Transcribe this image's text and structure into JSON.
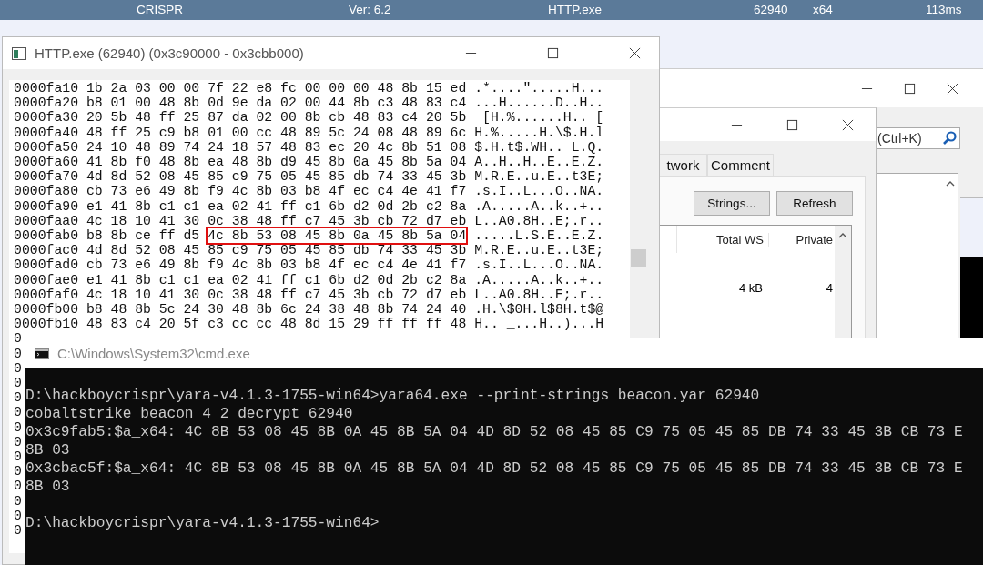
{
  "status_bar": {
    "items": [
      "CRISPR",
      "Ver: 6.2",
      "HTTP.exe",
      "62940",
      "x64",
      "113ms"
    ]
  },
  "main_window": {
    "search": {
      "placeholder": "(Ctrl+K)"
    }
  },
  "properties_window": {
    "tabs": [
      {
        "label": "twork",
        "selected": false
      },
      {
        "label": "Comment",
        "selected": false
      }
    ],
    "buttons": [
      "Strings...",
      "Refresh"
    ],
    "columns": [
      "Total WS",
      "Private"
    ],
    "rows": [
      {
        "total_ws": "4 kB",
        "private": "4"
      }
    ]
  },
  "hex_window": {
    "title": "HTTP.exe (62940) (0x3c90000 - 0x3cbb000)",
    "rows": [
      {
        "offset": "0000fa10",
        "segments": [
          {
            "text": "1b 2a 03 00 00 7f 22 e8 fc 00 00 00 48 8b 15 ed",
            "highlighted": false
          }
        ],
        "ascii": ".*....\".....H..."
      },
      {
        "offset": "0000fa20",
        "segments": [
          {
            "text": "b8 01 00 48 8b 0d 9e da 02 00 44 8b c3 48 83 c4",
            "highlighted": false
          }
        ],
        "ascii": "...H......D..H.."
      },
      {
        "offset": "0000fa30",
        "segments": [
          {
            "text": "20 5b 48 ff 25 87 da 02 00 8b cb 48 83 c4 20 5b",
            "highlighted": false
          }
        ],
        "ascii": " [H.%......H.. ["
      },
      {
        "offset": "0000fa40",
        "segments": [
          {
            "text": "48 ff 25 c9 b8 01 00 cc 48 89 5c 24 08 48 89 6c",
            "highlighted": false
          }
        ],
        "ascii": "H.%.....H.\\$.H.l"
      },
      {
        "offset": "0000fa50",
        "segments": [
          {
            "text": "24 10 48 89 74 24 18 57 48 83 ec 20 4c 8b 51 08",
            "highlighted": false
          }
        ],
        "ascii": "$.H.t$.WH.. L.Q."
      },
      {
        "offset": "0000fa60",
        "segments": [
          {
            "text": "41 8b f0 48 8b ea 48 8b d9 45 8b 0a 45 8b 5a 04",
            "highlighted": false
          }
        ],
        "ascii": "A..H..H..E..E.Z."
      },
      {
        "offset": "0000fa70",
        "segments": [
          {
            "text": "4d 8d 52 08 45 85 c9 75 05 45 85 db 74 33 45 3b",
            "highlighted": false
          }
        ],
        "ascii": "M.R.E..u.E..t3E;"
      },
      {
        "offset": "0000fa80",
        "segments": [
          {
            "text": "cb 73 e6 49 8b f9 4c 8b 03 b8 4f ec c4 4e 41 f7",
            "highlighted": false
          }
        ],
        "ascii": ".s.I..L...O..NA."
      },
      {
        "offset": "0000fa90",
        "segments": [
          {
            "text": "e1 41 8b c1 c1 ea 02 41 ff c1 6b d2 0d 2b c2 8a",
            "highlighted": false
          }
        ],
        "ascii": ".A.....A..k..+.."
      },
      {
        "offset": "0000faa0",
        "segments": [
          {
            "text": "4c 18 10 41 30 0c 38 48 ff c7 45 3b cb 72 d7 eb",
            "highlighted": false
          }
        ],
        "ascii": "L..A0.8H..E;.r.."
      },
      {
        "offset": "0000fab0",
        "segments": [
          {
            "text": "b8 8b ce ff d5",
            "highlighted": false
          },
          {
            "text": "4c 8b 53 08 45 8b 0a 45 8b 5a 04",
            "highlighted": true
          }
        ],
        "ascii": ".....L.S.E..E.Z."
      },
      {
        "offset": "0000fac0",
        "segments": [
          {
            "text": "4d 8d 52 08 45 85 c9 75 05 45 85 db 74 33 45 3b",
            "highlighted": false
          }
        ],
        "ascii": "M.R.E..u.E..t3E;"
      },
      {
        "offset": "0000fad0",
        "segments": [
          {
            "text": "cb 73 e6 49 8b f9 4c 8b 03 b8 4f ec c4 4e 41 f7",
            "highlighted": false
          }
        ],
        "ascii": ".s.I..L...O..NA."
      },
      {
        "offset": "0000fae0",
        "segments": [
          {
            "text": "e1 41 8b c1 c1 ea 02 41 ff c1 6b d2 0d 2b c2 8a",
            "highlighted": false
          }
        ],
        "ascii": ".A.....A..k..+.."
      },
      {
        "offset": "0000faf0",
        "segments": [
          {
            "text": "4c 18 10 41 30 0c 38 48 ff c7 45 3b cb 72 d7 eb",
            "highlighted": false
          }
        ],
        "ascii": "L..A0.8H..E;.r.."
      },
      {
        "offset": "0000fb00",
        "segments": [
          {
            "text": "b8 48 8b 5c 24 30 48 8b 6c 24 38 48 8b 74 24 40",
            "highlighted": false
          }
        ],
        "ascii": ".H.\\$0H.l$8H.t$@"
      },
      {
        "offset": "0000fb10",
        "segments": [
          {
            "text": "48 83 c4 20 5f c3 cc cc 48 8d 15 29 ff ff ff 48",
            "highlighted": false
          }
        ],
        "ascii": "H.. _...H..)...H"
      }
    ],
    "offset_fragments": [
      "0",
      "0",
      "0",
      "0",
      "0",
      "0",
      "0",
      "0",
      "0",
      "0",
      "0",
      "0",
      "0",
      "0"
    ]
  },
  "console": {
    "title": "C:\\Windows\\System32\\cmd.exe",
    "lines": [
      {
        "text": "D:\\hackboycrispr\\yara-v4.1.3-1755-win64>yara64.exe --print-strings beacon.yar 62940",
        "gap_before": true
      },
      {
        "text": "cobaltstrike_beacon_4_2_decrypt 62940",
        "gap_before": false
      },
      {
        "text": "0x3c9fab5:$a_x64: 4C 8B 53 08 45 8B 0A 45 8B 5A 04 4D 8D 52 08 45 85 C9 75 05 45 85 DB 74 33 45 3B CB 73 E",
        "gap_before": false
      },
      {
        "text": "8B 03",
        "gap_before": false
      },
      {
        "text": "0x3cbac5f:$a_x64: 4C 8B 53 08 45 8B 0A 45 8B 5A 04 4D 8D 52 08 45 85 C9 75 05 45 85 DB 74 33 45 3B CB 73 E",
        "gap_before": false
      },
      {
        "text": "8B 03",
        "gap_before": false
      },
      {
        "text": "D:\\hackboycrispr\\yara-v4.1.3-1755-win64>",
        "gap_before": true
      }
    ]
  }
}
